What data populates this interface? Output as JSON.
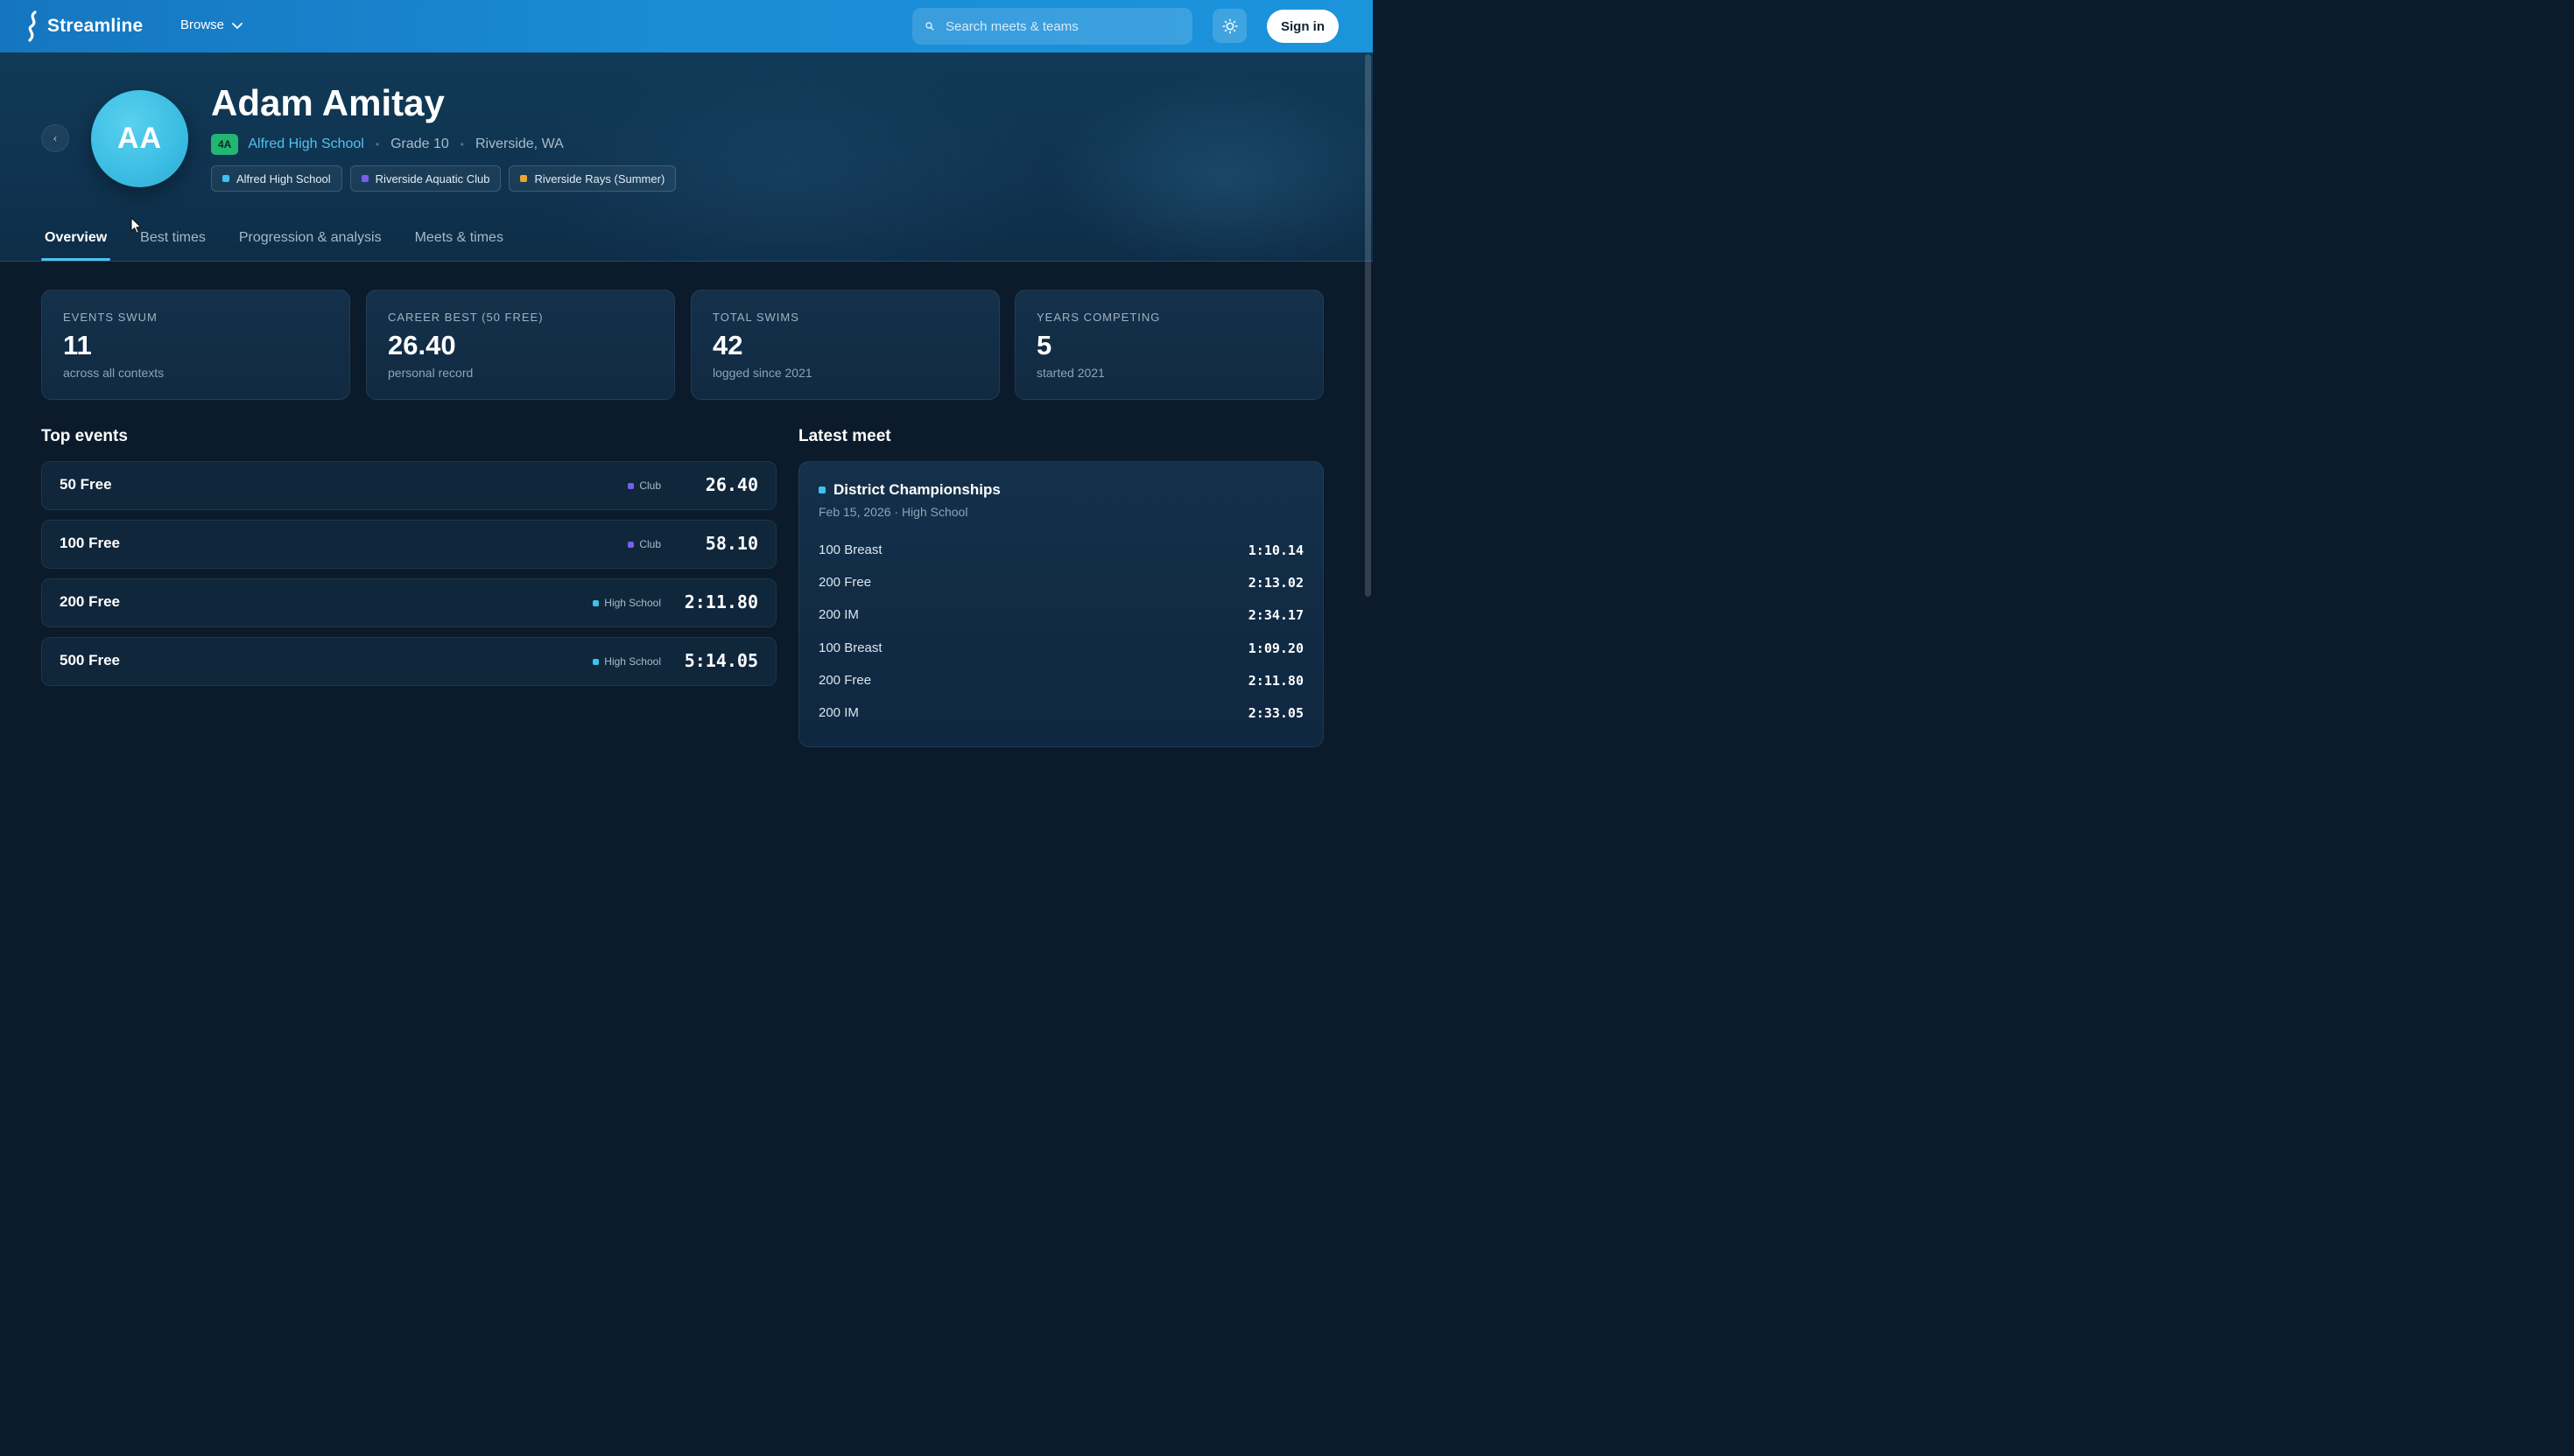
{
  "app": {
    "name": "Streamline"
  },
  "nav": {
    "browse_label": "Browse",
    "search_placeholder": "Search meets & teams",
    "sign_in_label": "Sign in"
  },
  "profile": {
    "initials": "AA",
    "name": "Adam Amitay",
    "classification": "4A",
    "school": "Alfred High School",
    "grade": "Grade 10",
    "location": "Riverside, WA",
    "teams": [
      {
        "label": "Alfred High School",
        "color": "#3cc2ee"
      },
      {
        "label": "Riverside Aquatic Club",
        "color": "#7a5cf0"
      },
      {
        "label": "Riverside Rays (Summer)",
        "color": "#e7a630"
      }
    ]
  },
  "tabs": [
    {
      "label": "Overview",
      "active": true
    },
    {
      "label": "Best times",
      "active": false
    },
    {
      "label": "Progression & analysis",
      "active": false
    },
    {
      "label": "Meets & times",
      "active": false
    }
  ],
  "stats": [
    {
      "label": "Events swum",
      "value": "11",
      "sub": "across all contexts"
    },
    {
      "label": "Career best (50 free)",
      "value": "26.40",
      "sub": "personal record"
    },
    {
      "label": "Total swims",
      "value": "42",
      "sub": "logged since 2021"
    },
    {
      "label": "Years competing",
      "value": "5",
      "sub": "started 2021"
    }
  ],
  "top_events": {
    "title": "Top events",
    "rows": [
      {
        "event": "50 Free",
        "context": "Club",
        "context_color": "#7a5cf0",
        "time": "26.40"
      },
      {
        "event": "100 Free",
        "context": "Club",
        "context_color": "#7a5cf0",
        "time": "58.10"
      },
      {
        "event": "200 Free",
        "context": "High School",
        "context_color": "#3cc2ee",
        "time": "2:11.80"
      },
      {
        "event": "500 Free",
        "context": "High School",
        "context_color": "#3cc2ee",
        "time": "5:14.05"
      }
    ]
  },
  "latest_meet": {
    "title": "Latest meet",
    "meet_name": "District Championships",
    "meet_sub": "Feb 15, 2026 · High School",
    "results": [
      {
        "event": "100 Breast",
        "time": "1:10.14"
      },
      {
        "event": "200 Free",
        "time": "2:13.02"
      },
      {
        "event": "200 IM",
        "time": "2:34.17"
      },
      {
        "event": "100 Breast",
        "time": "1:09.20"
      },
      {
        "event": "200 Free",
        "time": "2:11.80"
      },
      {
        "event": "200 IM",
        "time": "2:33.05"
      }
    ]
  },
  "icons": {
    "logo": "wave-logo-icon",
    "browse": "chevron-down-icon",
    "search": "search-icon",
    "theme": "sun-icon",
    "back": "chevron-left-icon"
  }
}
